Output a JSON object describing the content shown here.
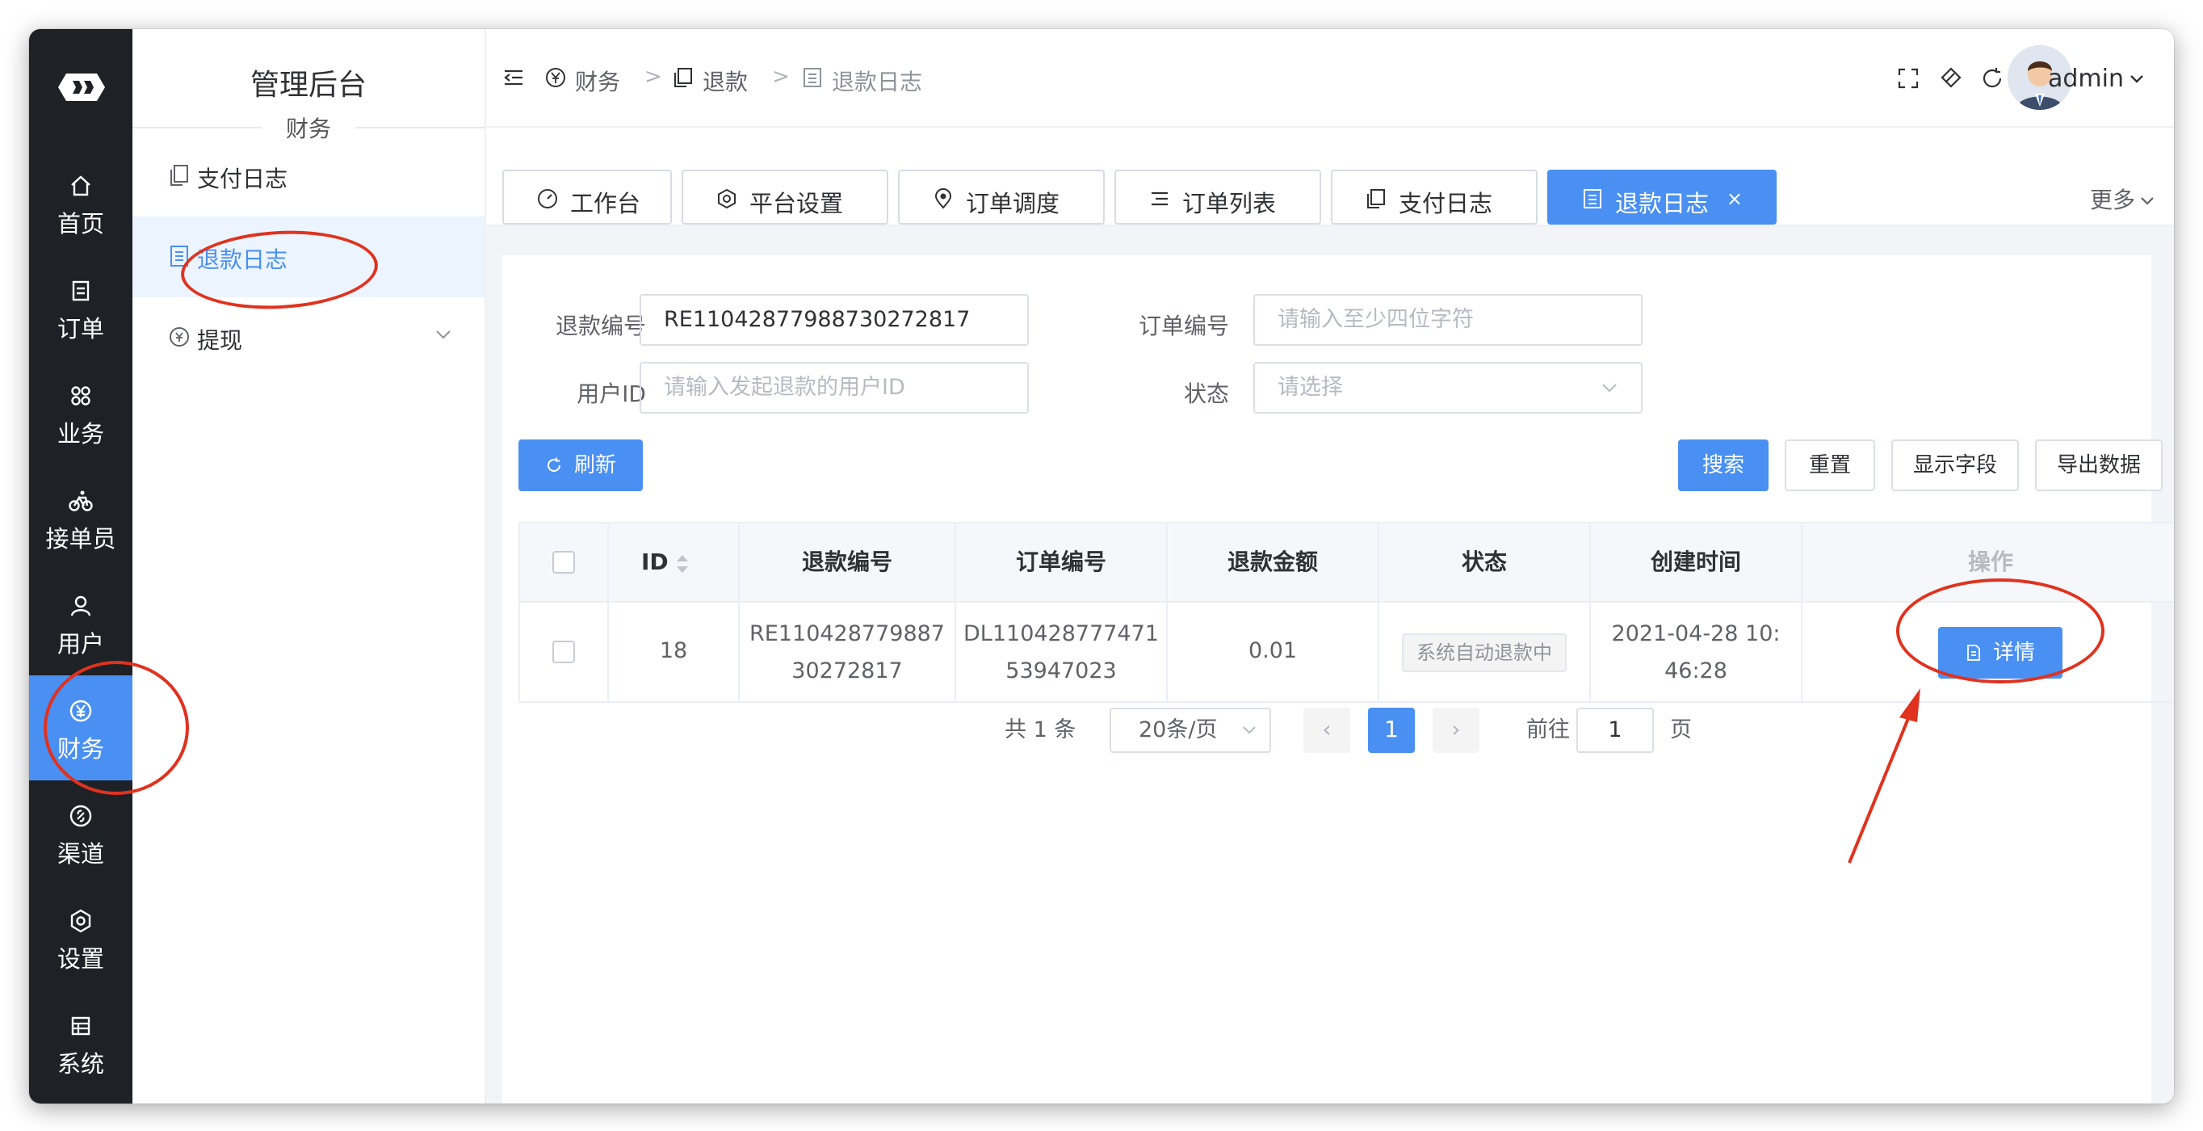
{
  "rail": {
    "items": [
      {
        "label": "首页",
        "icon": "home-icon"
      },
      {
        "label": "订单",
        "icon": "order-icon"
      },
      {
        "label": "业务",
        "icon": "grid-icon"
      },
      {
        "label": "接单员",
        "icon": "bike-icon"
      },
      {
        "label": "用户",
        "icon": "user-icon"
      },
      {
        "label": "财务",
        "icon": "yuan-icon"
      },
      {
        "label": "渠道",
        "icon": "channel-icon"
      },
      {
        "label": "设置",
        "icon": "gear-icon"
      },
      {
        "label": "系统",
        "icon": "system-icon"
      }
    ],
    "active": "财务"
  },
  "sidebar": {
    "title": "管理后台",
    "section": "财务",
    "items": [
      {
        "label": "支付日志"
      },
      {
        "label": "退款日志"
      },
      {
        "label": "提现"
      }
    ]
  },
  "header": {
    "breadcrumb": [
      "财务",
      "退款",
      "退款日志"
    ],
    "separator": ">",
    "user": "admin"
  },
  "tabs": {
    "items": [
      {
        "label": "工作台"
      },
      {
        "label": "平台设置"
      },
      {
        "label": "订单调度"
      },
      {
        "label": "订单列表"
      },
      {
        "label": "支付日志"
      },
      {
        "label": "退款日志"
      }
    ],
    "close": "×",
    "more": "更多"
  },
  "filters": {
    "refund_no_label": "退款编号",
    "refund_no_value": "RE110428779887302728​17",
    "order_no_label": "订单编号",
    "order_no_placeholder": "请输入至少四位字符",
    "user_id_label": "用户ID",
    "user_id_placeholder": "请输入发起退款的用户ID",
    "status_label": "状态",
    "status_placeholder": "请选择"
  },
  "actions": {
    "refresh": "刷新",
    "search": "搜索",
    "reset": "重置",
    "show_fields": "显示字段",
    "export": "导出数据"
  },
  "table": {
    "headers": [
      "ID",
      "退款编号",
      "订单编号",
      "退款金额",
      "状态",
      "创建时间",
      "操作"
    ],
    "rows": [
      {
        "id": "18",
        "refund_no_1": "RE110428779887",
        "refund_no_2": "30272817",
        "order_no_1": "DL110428777471",
        "order_no_2": "53947023",
        "amount": "0.01",
        "status": "系统自动退款中",
        "created_1": "2021-04-28 10:",
        "created_2": "46:28",
        "action": "详情"
      }
    ]
  },
  "pager": {
    "total": "共 1 条",
    "page_size": "20条/页",
    "prev": "‹",
    "current": "1",
    "next": "›",
    "goto_label": "前往",
    "goto_value": "1",
    "page_suffix": "页"
  },
  "colors": {
    "primary": "#4a90f2",
    "rail": "#1e2126",
    "annotation": "#e0321e"
  }
}
